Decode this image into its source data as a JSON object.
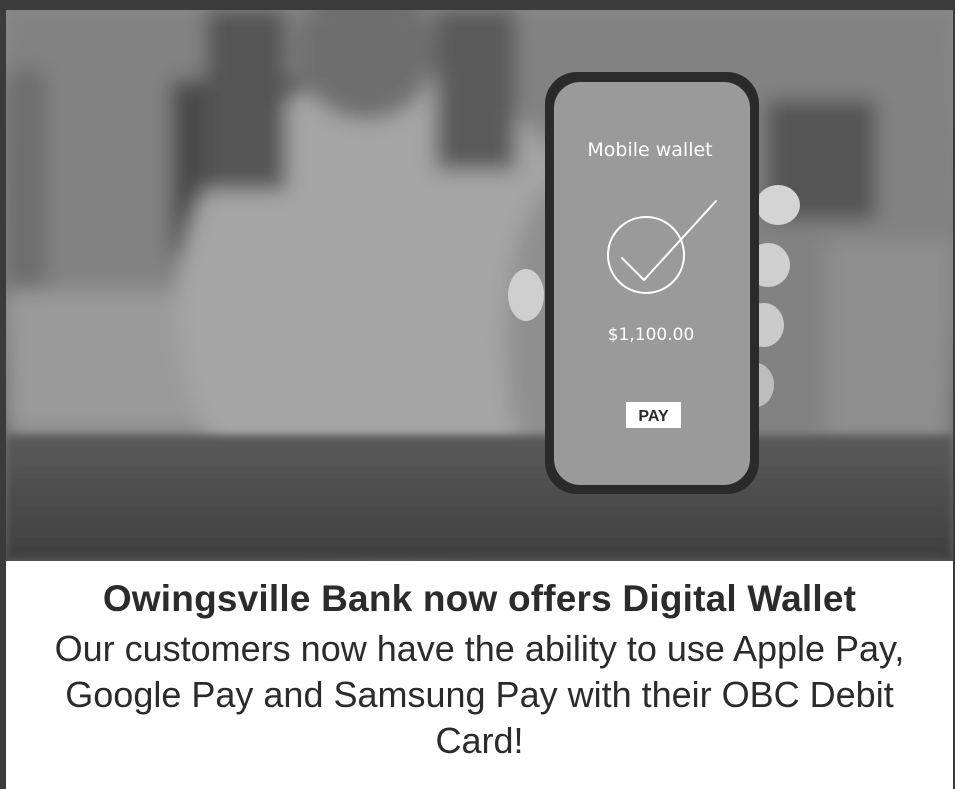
{
  "photo": {
    "phone_screen": {
      "title": "Mobile wallet",
      "amount": "$1,100.00",
      "pay_button_label": "PAY",
      "check_icon": "checkmark-circle-icon"
    }
  },
  "caption": {
    "headline": "Owingsville Bank now offers Digital Wallet",
    "body": "Our customers now have the ability to use Apple Pay, Google Pay and Samsung Pay with their OBC Debit Card!"
  },
  "colors": {
    "border": "#3b3b3b",
    "caption_background": "#ffffff",
    "text": "#2b2b2b",
    "pay_button_background": "#ffffff"
  }
}
